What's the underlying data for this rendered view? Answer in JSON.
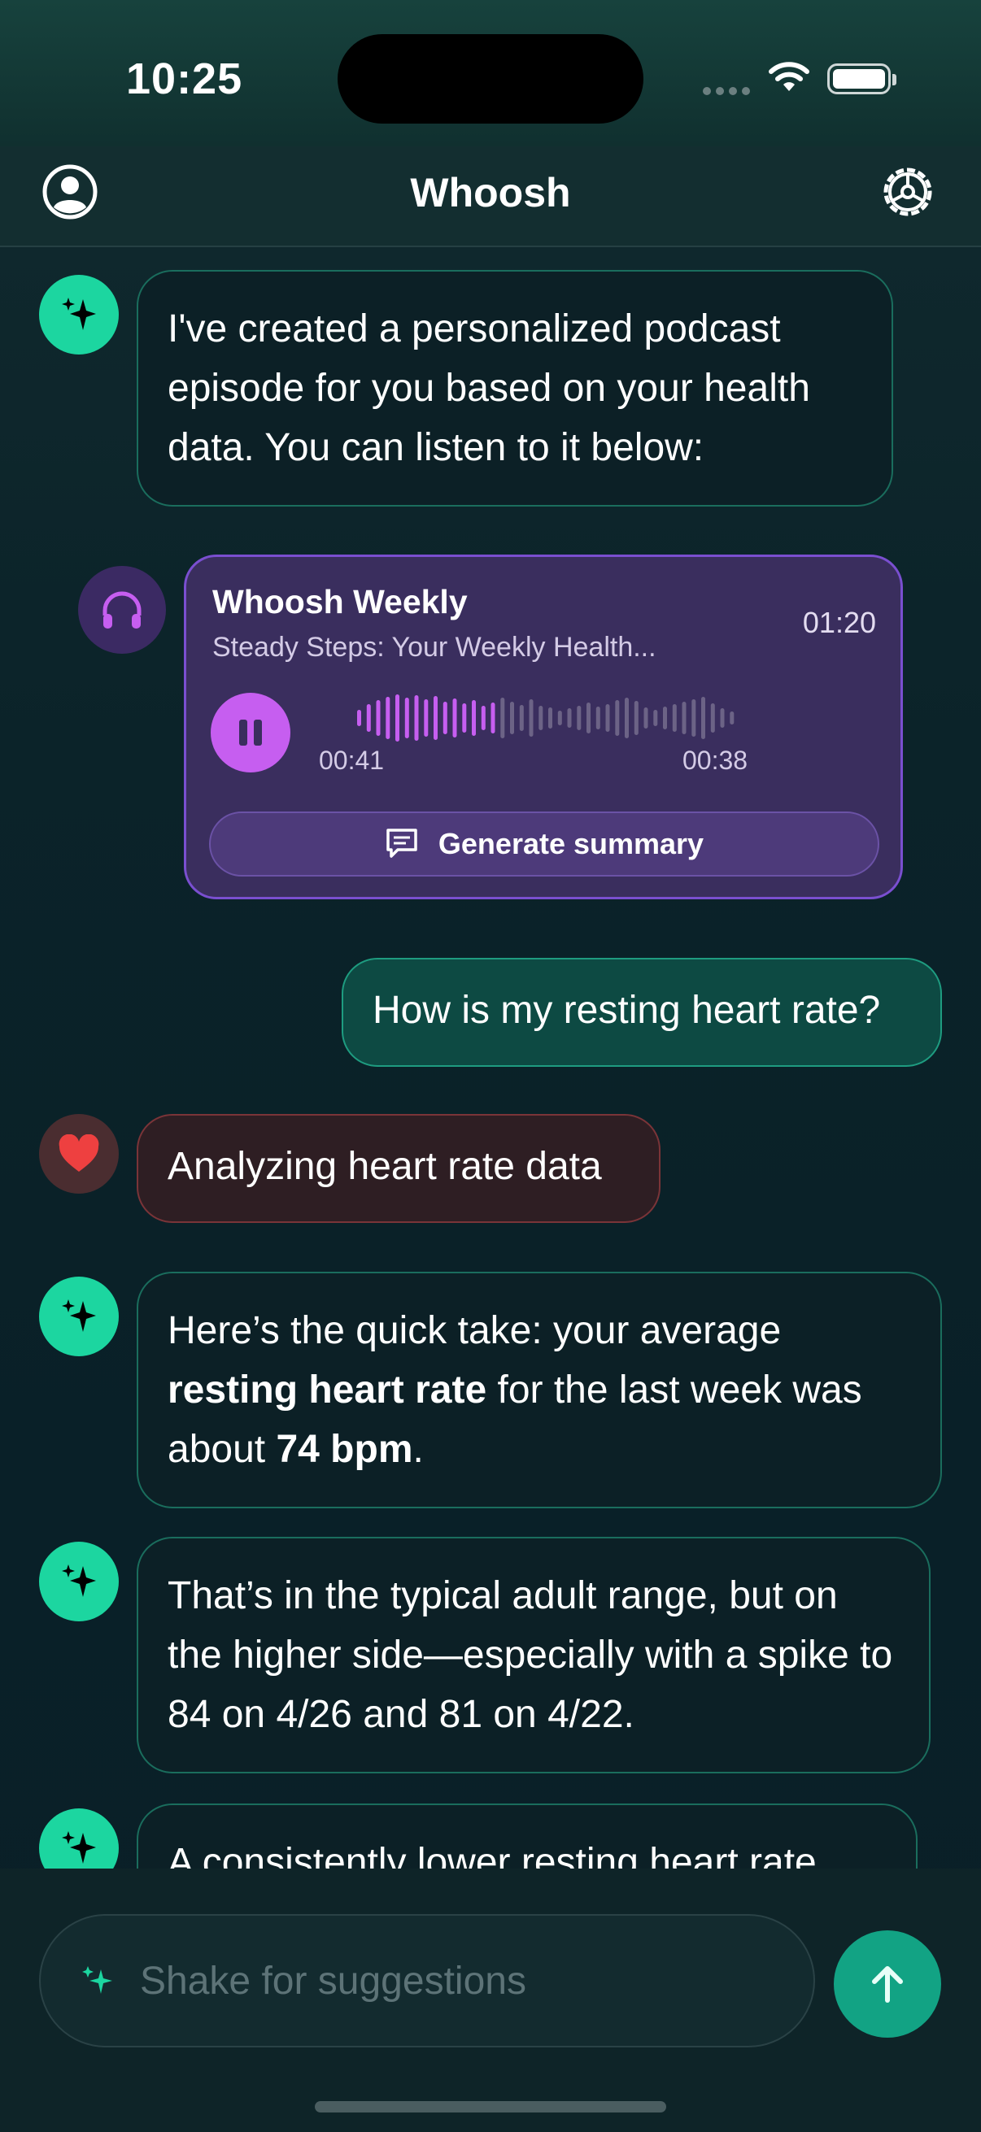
{
  "status_bar": {
    "time": "10:25"
  },
  "nav": {
    "title": "Whoosh"
  },
  "messages": [
    {
      "text": "I've created a personalized podcast episode for you based on your health data. You can listen to it below:"
    },
    {
      "text": "How is my resting heart rate?"
    },
    {
      "text": "Analyzing heart rate data"
    },
    {
      "p1": "Here’s the quick take: your average ",
      "b1": "resting heart rate",
      "p2": " for the last week was about ",
      "b2": "74 bpm",
      "p3": "."
    },
    {
      "text": "That’s in the typical adult range, but on the higher side—especially with a spike to 84 on 4/26 and 81 on 4/22."
    },
    {
      "text": "A consistently lower resting heart rate"
    }
  ],
  "podcast": {
    "name": "Whoosh Weekly",
    "episode": "Steady Steps: Your Weekly Health...",
    "duration": "01:20",
    "elapsed": "00:41",
    "remaining": "00:38",
    "progress": 0.38,
    "summary_label": "Generate summary"
  },
  "composer": {
    "placeholder": "Shake for suggestions"
  },
  "colors": {
    "accent": "#1cd6a0",
    "podcast_accent": "#c65ef0",
    "alert": "#ee4040"
  },
  "icons": [
    "profile-icon",
    "settings-icon",
    "sparkle-icon",
    "headphones-icon",
    "pause-icon",
    "chat-icon",
    "heart-icon",
    "arrow-up-icon"
  ]
}
